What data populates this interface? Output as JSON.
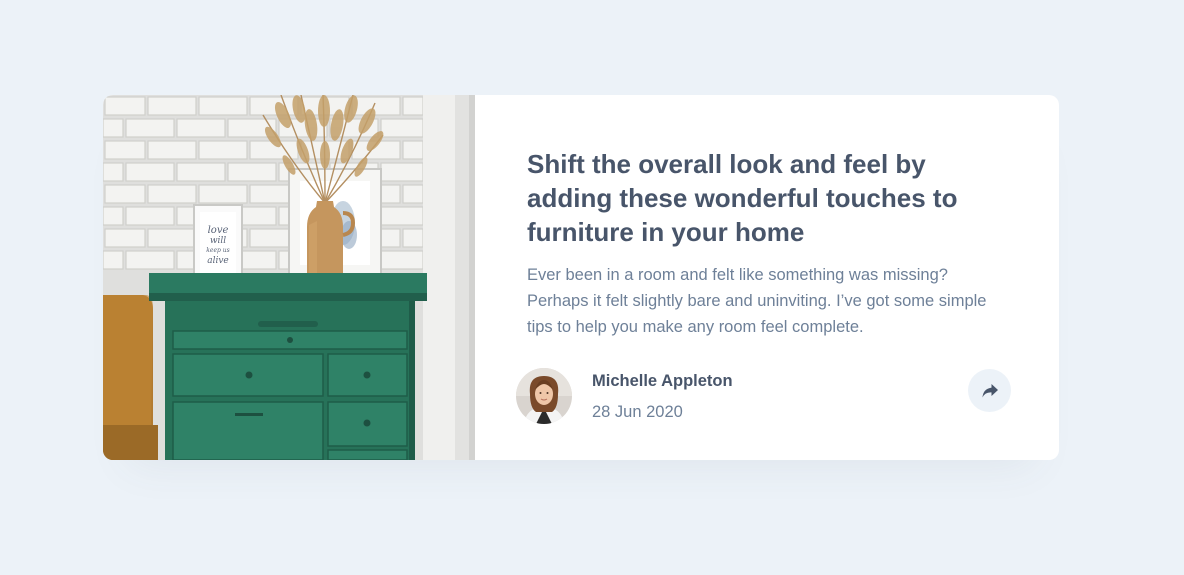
{
  "article": {
    "title": "Shift the overall look and feel by adding these wonderful touches to furniture in your home",
    "excerpt": "Ever been in a room and felt like something was missing? Perhaps it felt slightly bare and uninviting. I’ve got some simple tips to help you make any room feel complete.",
    "image_alt": "Green dresser with a vase of dried grass and picture frames against a white brick wall",
    "frame_text": "love will keep us alive"
  },
  "author": {
    "name": "Michelle Appleton",
    "date": "28 Jun 2020",
    "avatar_alt": "Michelle Appleton"
  },
  "share": {
    "icon": "share-arrow-icon",
    "label": "Share"
  },
  "colors": {
    "background": "#ecf2f8",
    "card": "#ffffff",
    "heading": "#48556a",
    "body_text": "#6e8098",
    "share_button_bg": "#ecf2f8",
    "dresser_green": "#2c7a63"
  }
}
